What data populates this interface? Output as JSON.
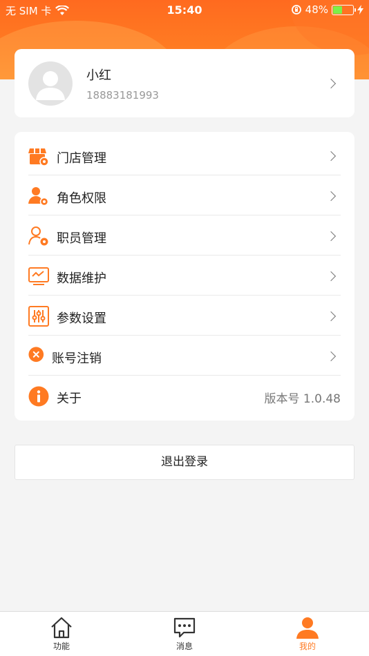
{
  "status_bar": {
    "carrier": "无 SIM 卡",
    "time": "15:40",
    "battery_percent": "48%",
    "battery_level": 0.48
  },
  "profile": {
    "name": "小红",
    "phone": "18883181993"
  },
  "menu": {
    "items": [
      {
        "label": "门店管理",
        "icon": "store-icon"
      },
      {
        "label": "角色权限",
        "icon": "role-permission-icon"
      },
      {
        "label": "职员管理",
        "icon": "staff-management-icon"
      },
      {
        "label": "数据维护",
        "icon": "data-maintenance-icon"
      },
      {
        "label": "参数设置",
        "icon": "settings-sliders-icon"
      },
      {
        "label": "账号注销",
        "icon": "close-circle-icon"
      },
      {
        "label": "关于",
        "icon": "info-icon",
        "value": "版本号 1.0.48"
      }
    ]
  },
  "logout_label": "退出登录",
  "tabbar": {
    "tabs": [
      {
        "label": "功能",
        "icon": "home-icon",
        "active": false
      },
      {
        "label": "消息",
        "icon": "message-icon",
        "active": false
      },
      {
        "label": "我的",
        "icon": "person-icon",
        "active": true
      }
    ]
  },
  "colors": {
    "accent": "#ff7a22",
    "battery_fill": "#7cf04a"
  }
}
